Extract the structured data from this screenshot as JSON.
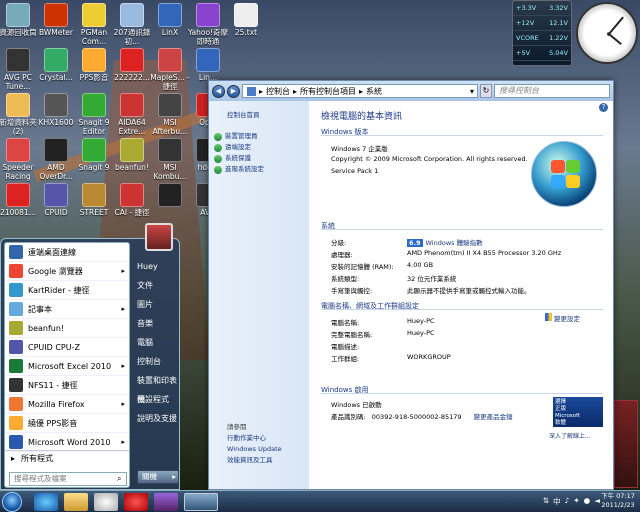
{
  "desktop": {
    "icons": [
      {
        "label": "資源回收筒",
        "color": "#7ab"
      },
      {
        "label": "BWMeter",
        "color": "#c30"
      },
      {
        "label": "PGMan Com...",
        "color": "#ec3"
      },
      {
        "label": "207通訊錄 初...",
        "color": "#9bd"
      },
      {
        "label": "LinX",
        "color": "#36b"
      },
      {
        "label": "Yahoo!奇摩即時通",
        "color": "#84c"
      },
      {
        "label": "25.txt",
        "color": "#eee"
      },
      {
        "label": "AVG PC Tune...",
        "color": "#333"
      },
      {
        "label": "Crystal...",
        "color": "#3a6"
      },
      {
        "label": "PPS影音",
        "color": "#fa3"
      },
      {
        "label": "222222...",
        "color": "#d22"
      },
      {
        "label": "MapleS... - 捷徑",
        "color": "#c44"
      },
      {
        "label": "Lin...",
        "color": "#36b"
      },
      {
        "label": "新增資料夾 (2)",
        "color": "#eb5"
      },
      {
        "label": "KHX1600",
        "color": "#555"
      },
      {
        "label": "Snagit 9 Editor",
        "color": "#3a3"
      },
      {
        "label": "AIDA64 Extre...",
        "color": "#c33"
      },
      {
        "label": "MSI Afterbu...",
        "color": "#444"
      },
      {
        "label": "Op...",
        "color": "#c22"
      },
      {
        "label": "Speeder Racing",
        "color": "#d44"
      },
      {
        "label": "AMD OverDr...",
        "color": "#222"
      },
      {
        "label": "Snagit 9",
        "color": "#3a3"
      },
      {
        "label": "beanfun!",
        "color": "#aa3"
      },
      {
        "label": "MSI Kombu...",
        "color": "#333"
      },
      {
        "label": "hdc...",
        "color": "#222"
      },
      {
        "label": "210081...",
        "color": "#d22"
      },
      {
        "label": "CPUID",
        "color": "#55a"
      },
      {
        "label": "STREET",
        "color": "#b83"
      },
      {
        "label": "CAI - 捷徑",
        "color": "#c33"
      },
      {
        "label": "",
        "color": "#222"
      },
      {
        "label": "AVG",
        "color": "#333"
      }
    ],
    "gadget_readings": [
      "+3.3V",
      "+12V",
      "VCORE",
      "+5V"
    ],
    "gadget_values": [
      "3.32V",
      "12.1V",
      "1.22V",
      "5.04V"
    ]
  },
  "start_menu": {
    "items": [
      {
        "label": "遠端桌面連線",
        "color": "#36a",
        "arrow": ""
      },
      {
        "label": "Google 瀏覽器",
        "color": "#e43",
        "arrow": "▸"
      },
      {
        "label": "KartRider - 捷徑",
        "color": "#39c",
        "arrow": ""
      },
      {
        "label": "記事本",
        "color": "#6ad",
        "arrow": "▸"
      },
      {
        "label": "beanfun!",
        "color": "#aa3",
        "arrow": ""
      },
      {
        "label": "CPUID CPU-Z",
        "color": "#55a",
        "arrow": ""
      },
      {
        "label": "Microsoft Excel 2010",
        "color": "#1a7a3a",
        "arrow": "▸"
      },
      {
        "label": "NFS11 - 捷徑",
        "color": "#333",
        "arrow": ""
      },
      {
        "label": "Mozilla Firefox",
        "color": "#e73",
        "arrow": "▸"
      },
      {
        "label": "繞優 PPS影音",
        "color": "#fa3",
        "arrow": ""
      },
      {
        "label": "Microsoft Word 2010",
        "color": "#2a5ab0",
        "arrow": "▸"
      }
    ],
    "all_programs": "所有程式",
    "search_placeholder": "搜尋程式及檔案",
    "user": "Huey",
    "right_items": [
      "Huey",
      "文件",
      "圖片",
      "音樂",
      "電腦",
      "控制台",
      "裝置和印表機",
      "預設程式",
      "說明及支援"
    ],
    "shutdown": "關機"
  },
  "explorer": {
    "breadcrumb": [
      "控制台",
      "所有控制台項目",
      "系統"
    ],
    "search_placeholder": "搜尋控制台",
    "side_top": [
      "控制台首頁"
    ],
    "side_links": [
      "裝置管理員",
      "遠端設定",
      "系統保護",
      "進階系統設定"
    ],
    "see_also_title": "請參閱",
    "see_also": [
      "行動作業中心",
      "Windows Update",
      "效能資訊及工具"
    ],
    "heading": "檢視電腦的基本資訊",
    "sections": {
      "edition": "Windows 版本",
      "system": "系統",
      "computer": "電腦名稱、網域及工作群組設定",
      "activation": "Windows 啟用"
    },
    "edition_lines": [
      "Windows 7 企業版",
      "Copyright © 2009 Microsoft Corporation. All rights reserved.",
      "Service Pack 1"
    ],
    "system_rows": [
      {
        "k": "分級:",
        "v": "Windows 體驗指數",
        "badge": "6.9"
      },
      {
        "k": "處理器:",
        "v": "AMD Phenom(tm) II X4 B55 Processor  3.20 GHz"
      },
      {
        "k": "安裝的記憶體 (RAM):",
        "v": "4.00 GB"
      },
      {
        "k": "系統類型:",
        "v": "32 位元作業系統"
      },
      {
        "k": "手寫筆與觸控:",
        "v": "此顯示器不提供手寫筆或觸控式輸入功能。"
      }
    ],
    "computer_rows": [
      {
        "k": "電腦名稱:",
        "v": "Huey-PC"
      },
      {
        "k": "完整電腦名稱:",
        "v": "Huey-PC"
      },
      {
        "k": "電腦描述:",
        "v": ""
      },
      {
        "k": "工作群組:",
        "v": "WORKGROUP"
      }
    ],
    "change_settings": "變更設定",
    "activation_status": "Windows 已啟動",
    "product_id_label": "產品識別碼:",
    "product_id": "00392-918-5000002-85179",
    "change_key": "變更產品金鑰",
    "genuine_lines": [
      "選擇",
      "正版",
      "Microsoft",
      "軟體"
    ],
    "genuine_link": "深入了解線上..."
  },
  "taskbar": {
    "ime": "中",
    "clock_time": "下午 07:17",
    "clock_date": "2011/2/23"
  }
}
